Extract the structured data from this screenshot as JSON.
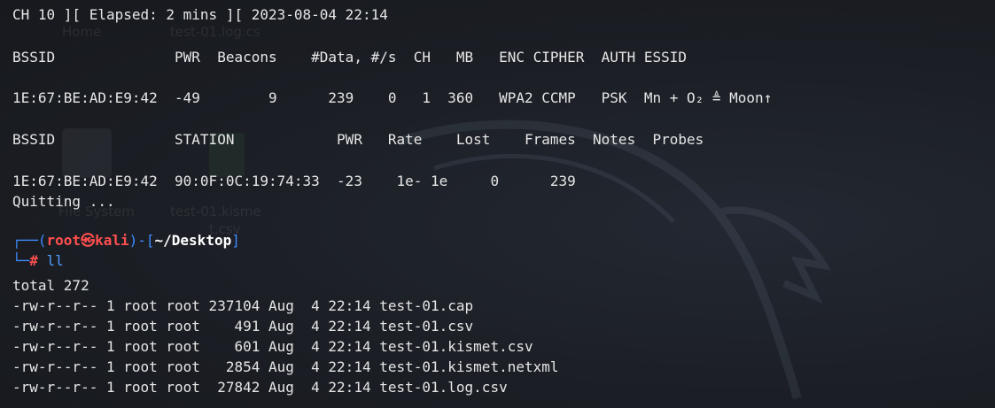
{
  "colors": {
    "background": "#1c1f26",
    "text": "#e6e6e6",
    "prompt_user": "#ff4f4f",
    "prompt_frame": "#3f8cff"
  },
  "airodump": {
    "status": "CH 10 ][ Elapsed: 2 mins ][ 2023-08-04 22:14",
    "ap_header": "BSSID              PWR  Beacons    #Data, #/s  CH   MB   ENC CIPHER  AUTH ESSID",
    "ap_row": "1E:67:BE:AD:E9:42  -49        9      239    0   1  360   WPA2 CCMP   PSK  Mn + O₂ ≜ Moon↑",
    "station_header": "BSSID              STATION            PWR   Rate    Lost    Frames  Notes  Probes",
    "station_row": "1E:67:BE:AD:E9:42  90:0F:0C:19:74:33  -23    1e- 1e     0      239"
  },
  "quitting": "Quitting ...",
  "prompt": {
    "frame_top_open": "┌──(",
    "user": "root",
    "at": "㉿",
    "host": "kali",
    "frame_mid": ")-[",
    "path": "~/Desktop",
    "frame_close": "]",
    "frame_bottom": "└─",
    "hash": "#",
    "command": "ll"
  },
  "listing": {
    "total": "total 272",
    "rows": [
      "-rw-r--r-- 1 root root 237104 Aug  4 22:14 test-01.cap",
      "-rw-r--r-- 1 root root    491 Aug  4 22:14 test-01.csv",
      "-rw-r--r-- 1 root root    601 Aug  4 22:14 test-01.kismet.csv",
      "-rw-r--r-- 1 root root   2854 Aug  4 22:14 test-01.kismet.netxml",
      "-rw-r--r-- 1 root root  27842 Aug  4 22:14 test-01.log.csv"
    ]
  },
  "background_desktop": {
    "home_label": "Home",
    "file_label_1": "test-01.log.cs",
    "file_system_label": "File System",
    "file_label_2": "test-01.kisme",
    "file_label_3": "t.csv"
  }
}
